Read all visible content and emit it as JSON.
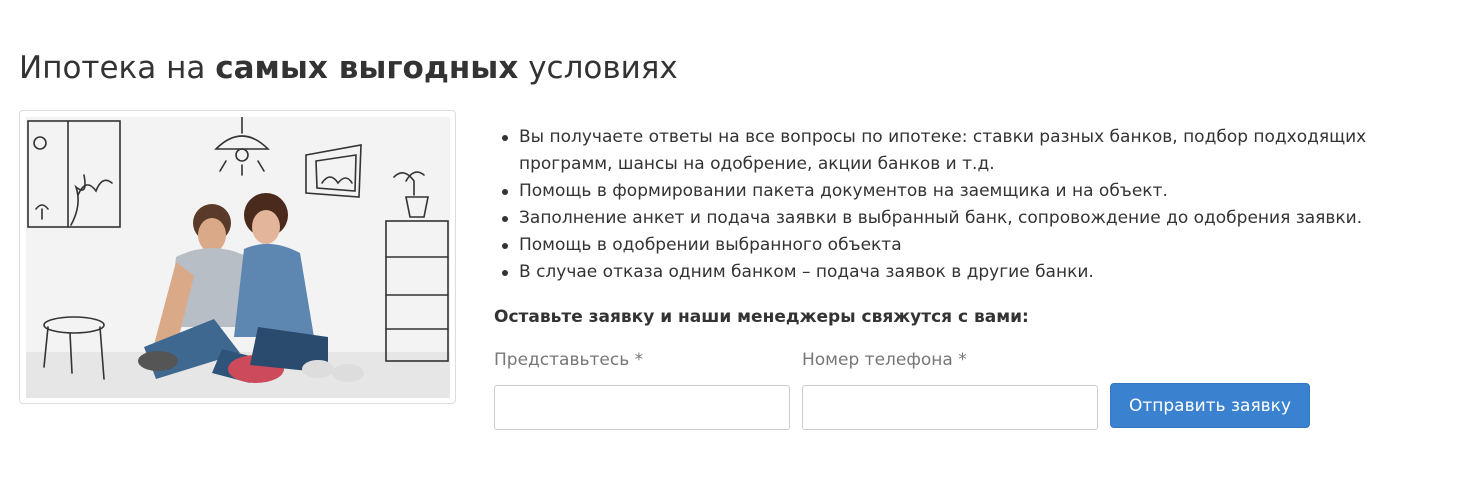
{
  "heading": {
    "part1": "Ипотека на ",
    "bold": "самых выгодных",
    "part2": " условиях"
  },
  "benefits": [
    "Вы получаете ответы на все вопросы по ипотеке: ставки разных банков, подбор подходящих программ, шансы на одобрение, акции банков и т.д.",
    "Помощь в формировании пакета документов на заемщика и на объект.",
    "Заполнение анкет и подача заявки в выбранный банк, сопровождение до одобрения заявки.",
    "Помощь в одобрении выбранного объекта",
    "В случае отказа одним банком – подача заявок в другие банки."
  ],
  "form": {
    "cta": "Оставьте заявку и наши менеджеры свяжутся с вами:",
    "name_label": "Представьтесь *",
    "name_value": "",
    "phone_label": "Номер телефона *",
    "phone_value": "",
    "submit_label": "Отправить заявку"
  },
  "colors": {
    "button": "#3a82cf",
    "text": "#333333",
    "muted": "#777777"
  }
}
